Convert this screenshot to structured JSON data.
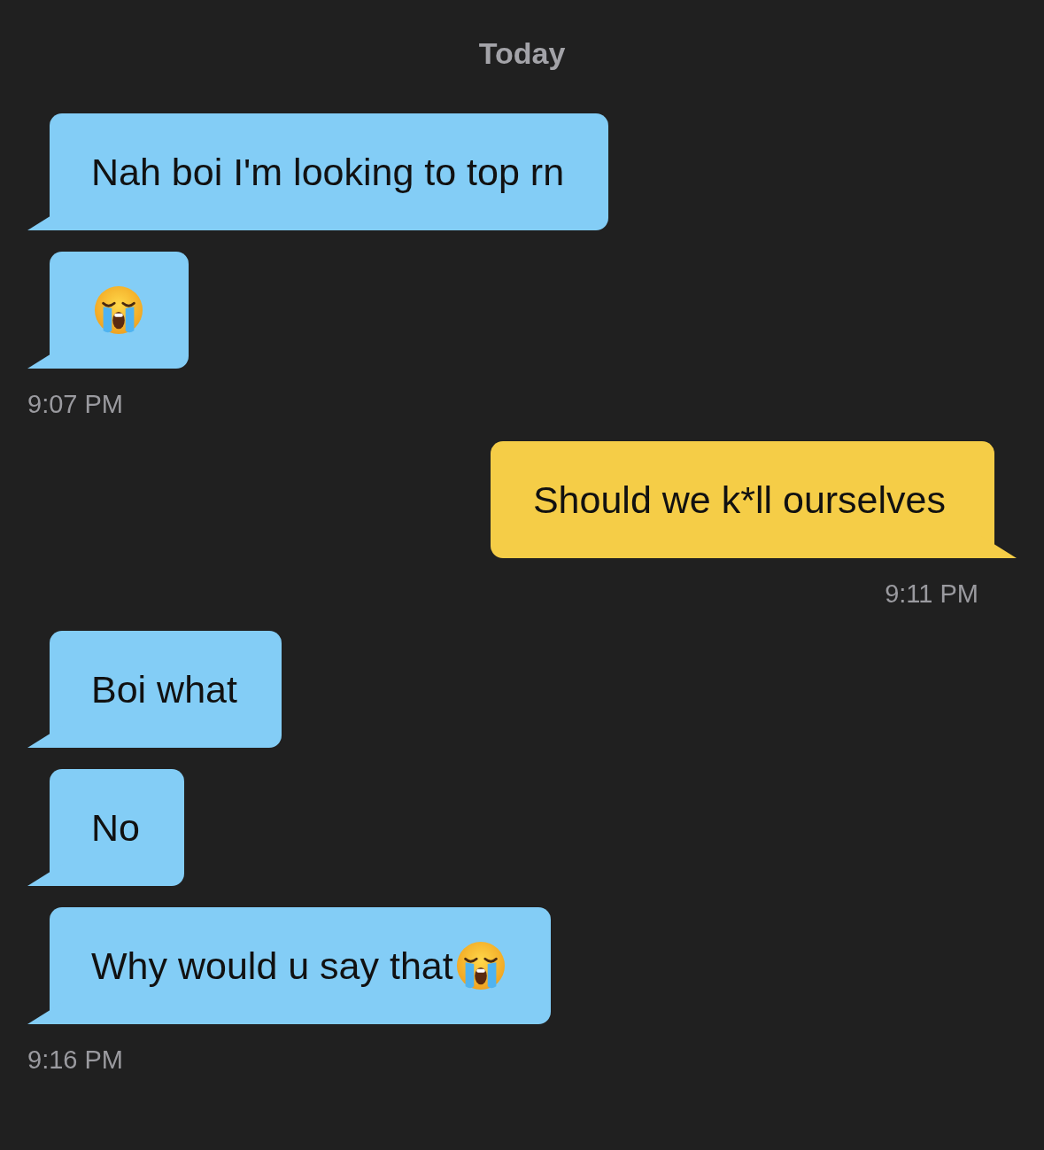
{
  "date_header": "Today",
  "groups": [
    {
      "kind": "incoming",
      "messages": [
        {
          "text": "Nah boi I'm looking to top rn",
          "crying_emoji": false
        },
        {
          "crying_emoji": true
        }
      ],
      "time": "9:07 PM"
    },
    {
      "kind": "outgoing",
      "messages": [
        {
          "text": "Should we k*ll ourselves",
          "crying_emoji": false
        }
      ],
      "time": "9:11 PM"
    },
    {
      "kind": "incoming",
      "messages": [
        {
          "text": "Boi what",
          "crying_emoji": false
        },
        {
          "text": "No",
          "crying_emoji": false
        },
        {
          "text": "Why would u say that",
          "crying_emoji": true
        }
      ],
      "time": "9:16 PM"
    }
  ]
}
